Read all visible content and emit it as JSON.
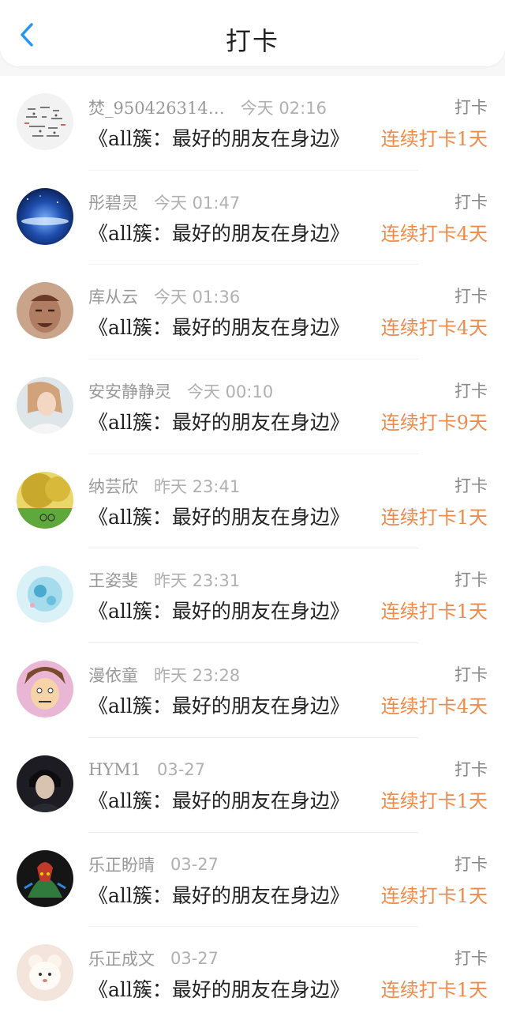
{
  "header": {
    "title": "打卡",
    "back_icon": "chevron-left-icon"
  },
  "colors": {
    "accent": "#2196f3",
    "streak": "#f08a4b",
    "muted": "#999999"
  },
  "entries": [
    {
      "username": "焚_950426314…",
      "time": "今天 02:16",
      "tag": "打卡",
      "topic": "《all簇：最好的朋友在身边》",
      "streak": "连续打卡1天"
    },
    {
      "username": "彤碧灵",
      "time": "今天 01:47",
      "tag": "打卡",
      "topic": "《all簇：最好的朋友在身边》",
      "streak": "连续打卡4天"
    },
    {
      "username": "库从云",
      "time": "今天 01:36",
      "tag": "打卡",
      "topic": "《all簇：最好的朋友在身边》",
      "streak": "连续打卡4天"
    },
    {
      "username": "安安静静灵",
      "time": "今天 00:10",
      "tag": "打卡",
      "topic": "《all簇：最好的朋友在身边》",
      "streak": "连续打卡9天"
    },
    {
      "username": "纳芸欣",
      "time": "昨天 23:41",
      "tag": "打卡",
      "topic": "《all簇：最好的朋友在身边》",
      "streak": "连续打卡1天"
    },
    {
      "username": "王姿斐",
      "time": "昨天 23:31",
      "tag": "打卡",
      "topic": "《all簇：最好的朋友在身边》",
      "streak": "连续打卡1天"
    },
    {
      "username": "漫依童",
      "time": "昨天 23:28",
      "tag": "打卡",
      "topic": "《all簇：最好的朋友在身边》",
      "streak": "连续打卡4天"
    },
    {
      "username": "HYM1",
      "time": "03-27",
      "tag": "打卡",
      "topic": "《all簇：最好的朋友在身边》",
      "streak": "连续打卡1天"
    },
    {
      "username": "乐正盼晴",
      "time": "03-27",
      "tag": "打卡",
      "topic": "《all簇：最好的朋友在身边》",
      "streak": "连续打卡1天"
    },
    {
      "username": "乐正成文",
      "time": "03-27",
      "tag": "打卡",
      "topic": "《all簇：最好的朋友在身边》",
      "streak": "连续打卡1天"
    }
  ]
}
